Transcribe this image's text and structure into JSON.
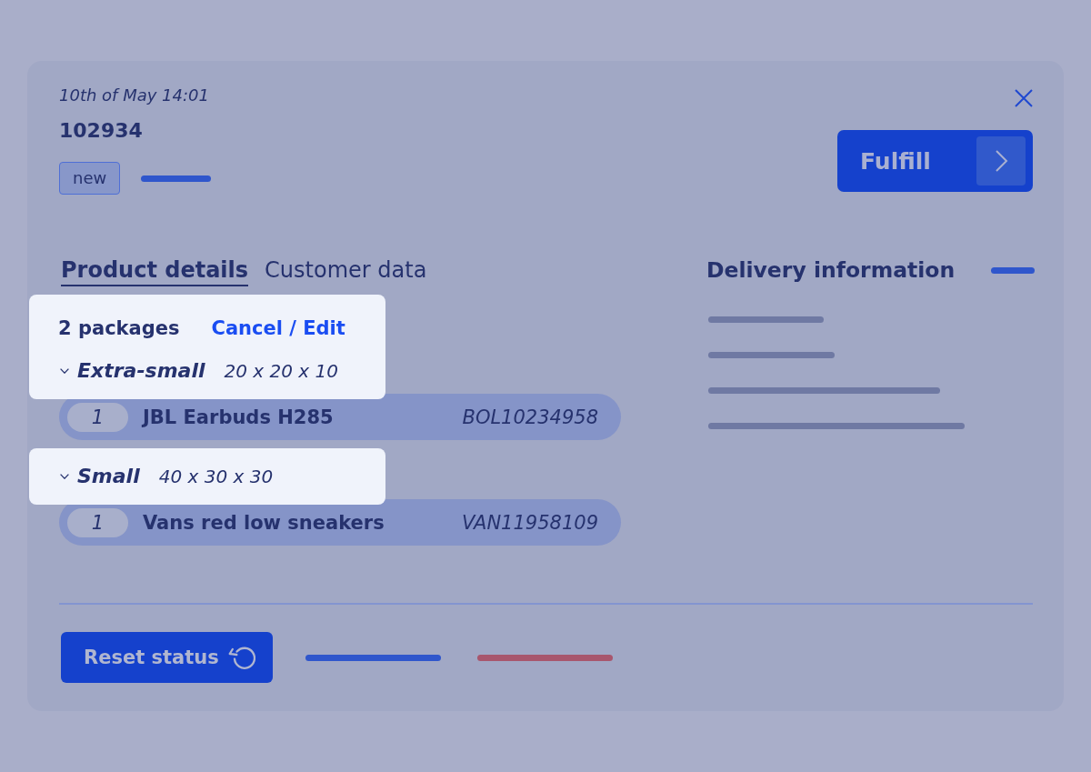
{
  "order": {
    "timestamp": "10th of May 14:01",
    "number": "102934",
    "status": "new"
  },
  "fulfill_button": {
    "label": "Fulfill"
  },
  "tabs": [
    {
      "label": "Product details",
      "selected": true
    },
    {
      "label": "Customer data",
      "selected": false
    }
  ],
  "packages": {
    "count": "2 packages",
    "action_link": "Cancel / Edit",
    "groups": [
      {
        "size": "Extra-small",
        "dimensions": "20 x 20 x 10",
        "expanded": true,
        "items": [
          {
            "quantity": "1",
            "name": "JBL Earbuds H285",
            "sku": "BOL10234958"
          }
        ]
      },
      {
        "size": "Small",
        "dimensions": "40 x 30 x 30",
        "expanded": true,
        "items": [
          {
            "quantity": "1",
            "name": "Vans red low sneakers",
            "sku": "VAN11958109"
          }
        ]
      }
    ]
  },
  "delivery": {
    "title": "Delivery information"
  },
  "reset_button": {
    "label": "Reset status"
  }
}
